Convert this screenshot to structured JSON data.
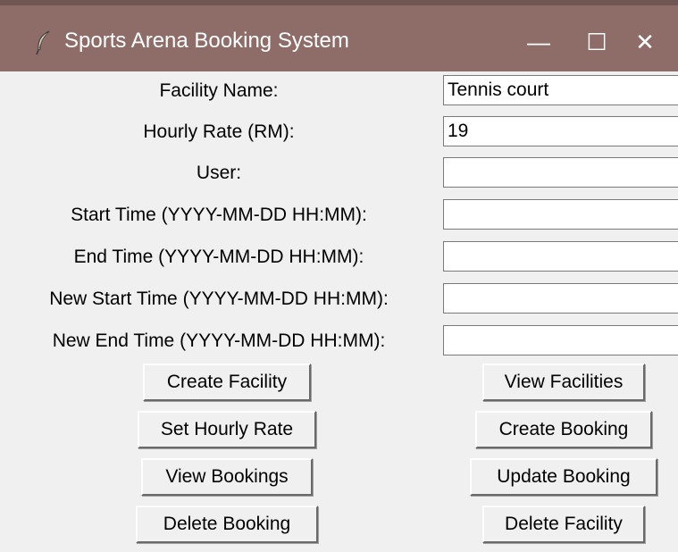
{
  "window": {
    "title": "Sports Arena Booking System",
    "icon": "feather-icon",
    "controls": {
      "minimize": "—",
      "maximize": "☐",
      "close": "✕"
    }
  },
  "form": {
    "labels": {
      "facility_name": "Facility Name:",
      "hourly_rate": "Hourly Rate (RM):",
      "user": "User:",
      "start_time": "Start Time (YYYY-MM-DD HH:MM):",
      "end_time": "End Time (YYYY-MM-DD HH:MM):",
      "new_start_time": "New Start Time (YYYY-MM-DD HH:MM):",
      "new_end_time": "New End Time (YYYY-MM-DD HH:MM):"
    },
    "values": {
      "facility_name": "Tennis court",
      "hourly_rate": "19",
      "user": "",
      "start_time": "",
      "end_time": "",
      "new_start_time": "",
      "new_end_time": ""
    }
  },
  "buttons": {
    "create_facility": "Create Facility",
    "view_facilities": "View Facilities",
    "set_hourly_rate": "Set Hourly Rate",
    "create_booking": "Create Booking",
    "view_bookings": "View Bookings",
    "update_booking": "Update Booking",
    "delete_booking": "Delete Booking",
    "delete_facility": "Delete Facility"
  },
  "colors": {
    "titlebar": "#8e6d69",
    "background": "#f0f0f0"
  }
}
